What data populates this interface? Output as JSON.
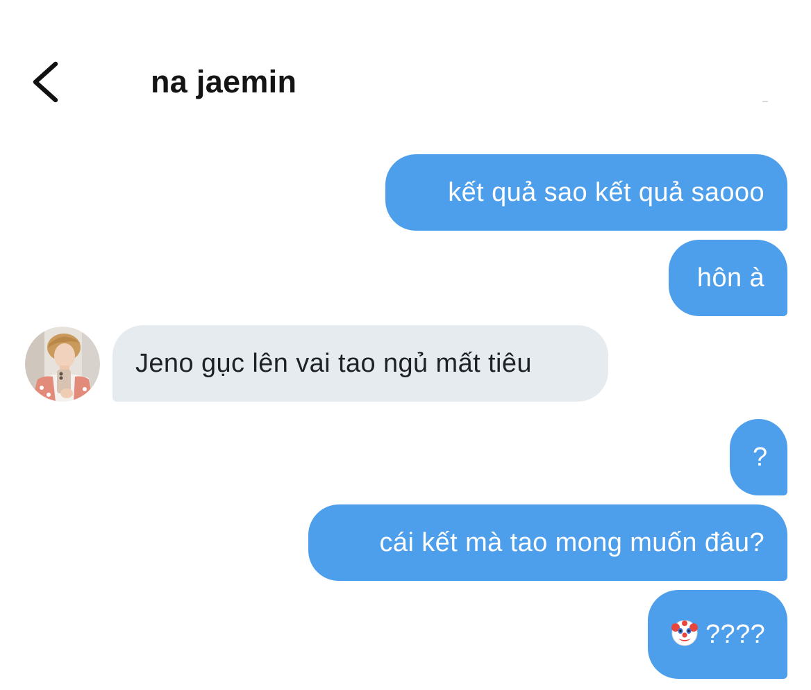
{
  "header": {
    "back_icon": "chevron-left-icon",
    "title": "na jaemin"
  },
  "messages": [
    {
      "direction": "out",
      "text": "kết quả sao kết quả saooo"
    },
    {
      "direction": "out",
      "text": "hôn à"
    },
    {
      "direction": "in",
      "text": "Jeno gục lên vai tao ngủ mất tiêu",
      "avatar": "avatar-photo"
    },
    {
      "direction": "out",
      "text": "?"
    },
    {
      "direction": "out",
      "text": "cái kết mà tao mong muốn đâu?"
    },
    {
      "direction": "out",
      "emoji": "clown-face-icon",
      "text": "????"
    }
  ],
  "colors": {
    "outgoing_bubble": "#4e9feb",
    "incoming_bubble": "#e6ebf0",
    "outgoing_text": "#ffffff",
    "incoming_text": "#1e2226"
  }
}
